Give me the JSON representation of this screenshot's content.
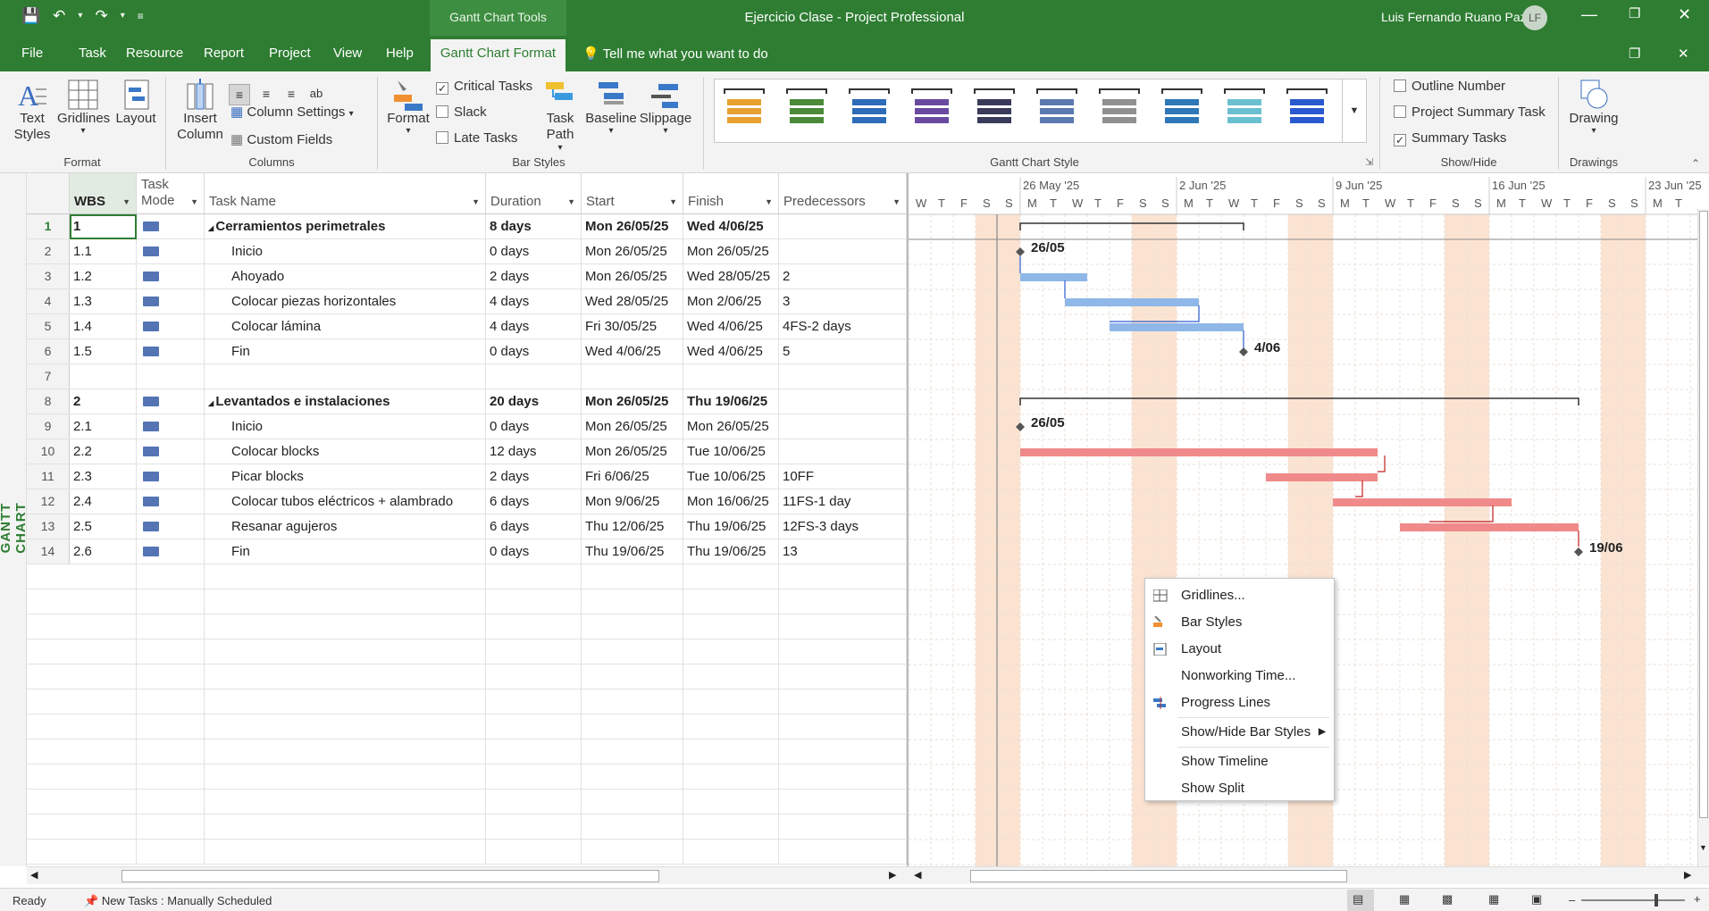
{
  "titlebar": {
    "context_tab": "Gantt Chart Tools",
    "title": "Ejercicio Clase  -  Project Professional",
    "user": "Luis Fernando Ruano Paz",
    "avatar": "LF"
  },
  "menu": {
    "items": [
      "File",
      "Task",
      "Resource",
      "Report",
      "Project",
      "View",
      "Help"
    ],
    "active": "Gantt Chart Format",
    "tell_me": "Tell me what you want to do"
  },
  "ribbon": {
    "format_group": {
      "text_styles": "Text Styles",
      "gridlines": "Gridlines",
      "layout": "Layout",
      "label": "Format"
    },
    "columns_group": {
      "insert_column": "Insert Column",
      "column_settings": "Column Settings",
      "custom_fields": "Custom Fields",
      "label": "Columns"
    },
    "bar_styles_group": {
      "format": "Format",
      "critical_tasks": "Critical Tasks",
      "slack": "Slack",
      "late_tasks": "Late Tasks",
      "critical_checked": true,
      "task_path": "Task Path",
      "baseline": "Baseline",
      "slippage": "Slippage",
      "label": "Bar Styles"
    },
    "gantt_style_label": "Gantt Chart Style",
    "gantt_style_colors": [
      "#e8a030",
      "#4a8a38",
      "#2e6bb8",
      "#6a4aa0",
      "#3a3a5a",
      "#5a7ab0",
      "#909090",
      "#2e78b8",
      "#6ac0d0",
      "#2a5ad0"
    ],
    "show_hide_group": {
      "outline_number": "Outline Number",
      "project_summary": "Project Summary Task",
      "summary_tasks": "Summary Tasks",
      "summary_checked": true,
      "label": "Show/Hide"
    },
    "drawings_group": {
      "drawing": "Drawing",
      "label": "Drawings"
    }
  },
  "table": {
    "side_label": "GANTT CHART",
    "headers": {
      "wbs": "WBS",
      "mode": "Task Mode",
      "name": "Task Name",
      "duration": "Duration",
      "start": "Start",
      "finish": "Finish",
      "pred": "Predecessors"
    },
    "rows": [
      {
        "n": "1",
        "wbs": "1",
        "name": "Cerramientos perimetrales",
        "dur": "8 days",
        "start": "Mon 26/05/25",
        "finish": "Wed 4/06/25",
        "pred": "",
        "summary": true
      },
      {
        "n": "2",
        "wbs": "1.1",
        "name": "Inicio",
        "dur": "0 days",
        "start": "Mon 26/05/25",
        "finish": "Mon 26/05/25",
        "pred": ""
      },
      {
        "n": "3",
        "wbs": "1.2",
        "name": "Ahoyado",
        "dur": "2 days",
        "start": "Mon 26/05/25",
        "finish": "Wed 28/05/25",
        "pred": "2"
      },
      {
        "n": "4",
        "wbs": "1.3",
        "name": "Colocar piezas horizontales",
        "dur": "4 days",
        "start": "Wed 28/05/25",
        "finish": "Mon 2/06/25",
        "pred": "3"
      },
      {
        "n": "5",
        "wbs": "1.4",
        "name": "Colocar lámina",
        "dur": "4 days",
        "start": "Fri 30/05/25",
        "finish": "Wed 4/06/25",
        "pred": "4FS-2 days"
      },
      {
        "n": "6",
        "wbs": "1.5",
        "name": "Fin",
        "dur": "0 days",
        "start": "Wed 4/06/25",
        "finish": "Wed 4/06/25",
        "pred": "5"
      },
      {
        "n": "7",
        "wbs": "",
        "name": "",
        "dur": "",
        "start": "",
        "finish": "",
        "pred": ""
      },
      {
        "n": "8",
        "wbs": "2",
        "name": "Levantados e instalaciones",
        "dur": "20 days",
        "start": "Mon 26/05/25",
        "finish": "Thu 19/06/25",
        "pred": "",
        "summary": true
      },
      {
        "n": "9",
        "wbs": "2.1",
        "name": "Inicio",
        "dur": "0 days",
        "start": "Mon 26/05/25",
        "finish": "Mon 26/05/25",
        "pred": ""
      },
      {
        "n": "10",
        "wbs": "2.2",
        "name": "Colocar blocks",
        "dur": "12 days",
        "start": "Mon 26/05/25",
        "finish": "Tue 10/06/25",
        "pred": ""
      },
      {
        "n": "11",
        "wbs": "2.3",
        "name": "Picar blocks",
        "dur": "2 days",
        "start": "Fri 6/06/25",
        "finish": "Tue 10/06/25",
        "pred": "10FF"
      },
      {
        "n": "12",
        "wbs": "2.4",
        "name": "Colocar tubos eléctricos +  alambrado",
        "dur": "6 days",
        "start": "Mon 9/06/25",
        "finish": "Mon 16/06/25",
        "pred": "11FS-1 day"
      },
      {
        "n": "13",
        "wbs": "2.5",
        "name": "Resanar agujeros",
        "dur": "6 days",
        "start": "Thu 12/06/25",
        "finish": "Thu 19/06/25",
        "pred": "12FS-3 days"
      },
      {
        "n": "14",
        "wbs": "2.6",
        "name": "Fin",
        "dur": "0 days",
        "start": "Thu 19/06/25",
        "finish": "Thu 19/06/25",
        "pred": "13"
      }
    ]
  },
  "gantt": {
    "weeks": [
      "'25",
      "26 May '25",
      "2 Jun '25",
      "9 Jun '25",
      "16 Jun '25",
      "23 Jun '25"
    ],
    "day_letters": [
      "W",
      "T",
      "F",
      "S",
      "S",
      "M",
      "T",
      "W",
      "T",
      "F",
      "S",
      "S",
      "M",
      "T",
      "W",
      "T",
      "F",
      "S",
      "S",
      "M",
      "T",
      "W",
      "T",
      "F",
      "S",
      "S",
      "M",
      "T",
      "W",
      "T",
      "F",
      "S",
      "S",
      "M",
      "T"
    ],
    "milestone_labels": [
      "26/05",
      "4/06",
      "26/05",
      "19/06"
    ],
    "blue": "#8fb8e8",
    "red": "#f08a8a",
    "weekend": "#fbe3d2"
  },
  "context_menu": {
    "items": [
      "Gridlines...",
      "Bar Styles",
      "Layout",
      "Nonworking Time...",
      "Progress Lines",
      "Show/Hide Bar Styles",
      "Show Timeline",
      "Show Split"
    ]
  },
  "status": {
    "ready": "Ready",
    "new_tasks": "New Tasks : Manually Scheduled"
  }
}
